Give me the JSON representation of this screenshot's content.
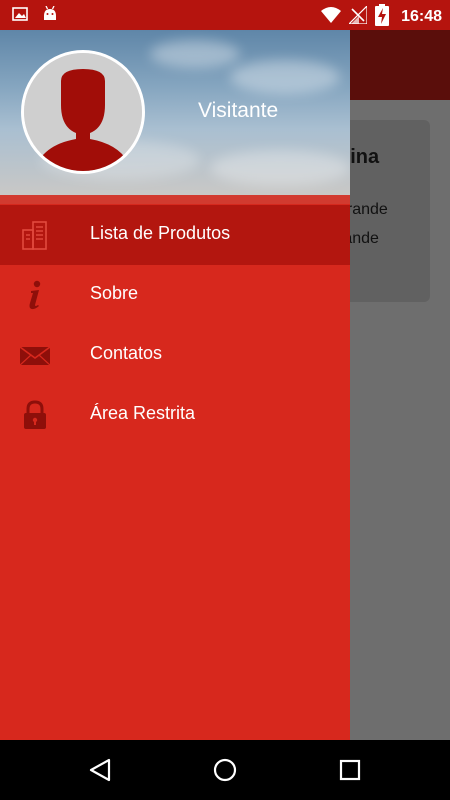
{
  "status_bar": {
    "time": "16:48",
    "left_icons": [
      "image-icon",
      "android-icon"
    ],
    "right_icons": [
      "wifi-icon",
      "signal-icon",
      "battery-charging-icon"
    ]
  },
  "drawer": {
    "user_name": "Visitante",
    "items": [
      {
        "label": "Lista de Produtos",
        "icon": "buildings-icon",
        "active": true
      },
      {
        "label": "Sobre",
        "icon": "info-icon",
        "active": false
      },
      {
        "label": "Contatos",
        "icon": "mail-icon",
        "active": false
      },
      {
        "label": "Área Restrita",
        "icon": "lock-icon",
        "active": false
      }
    ]
  },
  "background_page": {
    "card_title_fragment": "uina",
    "card_line1_fragment": "grande",
    "card_line2_fragment": "rande"
  },
  "colors": {
    "status_bar": "#b5140e",
    "drawer": "#d7281d",
    "drawer_active": "#b3160f",
    "icon_dark_red": "#8e0f0a"
  },
  "nav_bar": {
    "buttons": [
      "back-icon",
      "home-icon",
      "recents-icon"
    ]
  }
}
